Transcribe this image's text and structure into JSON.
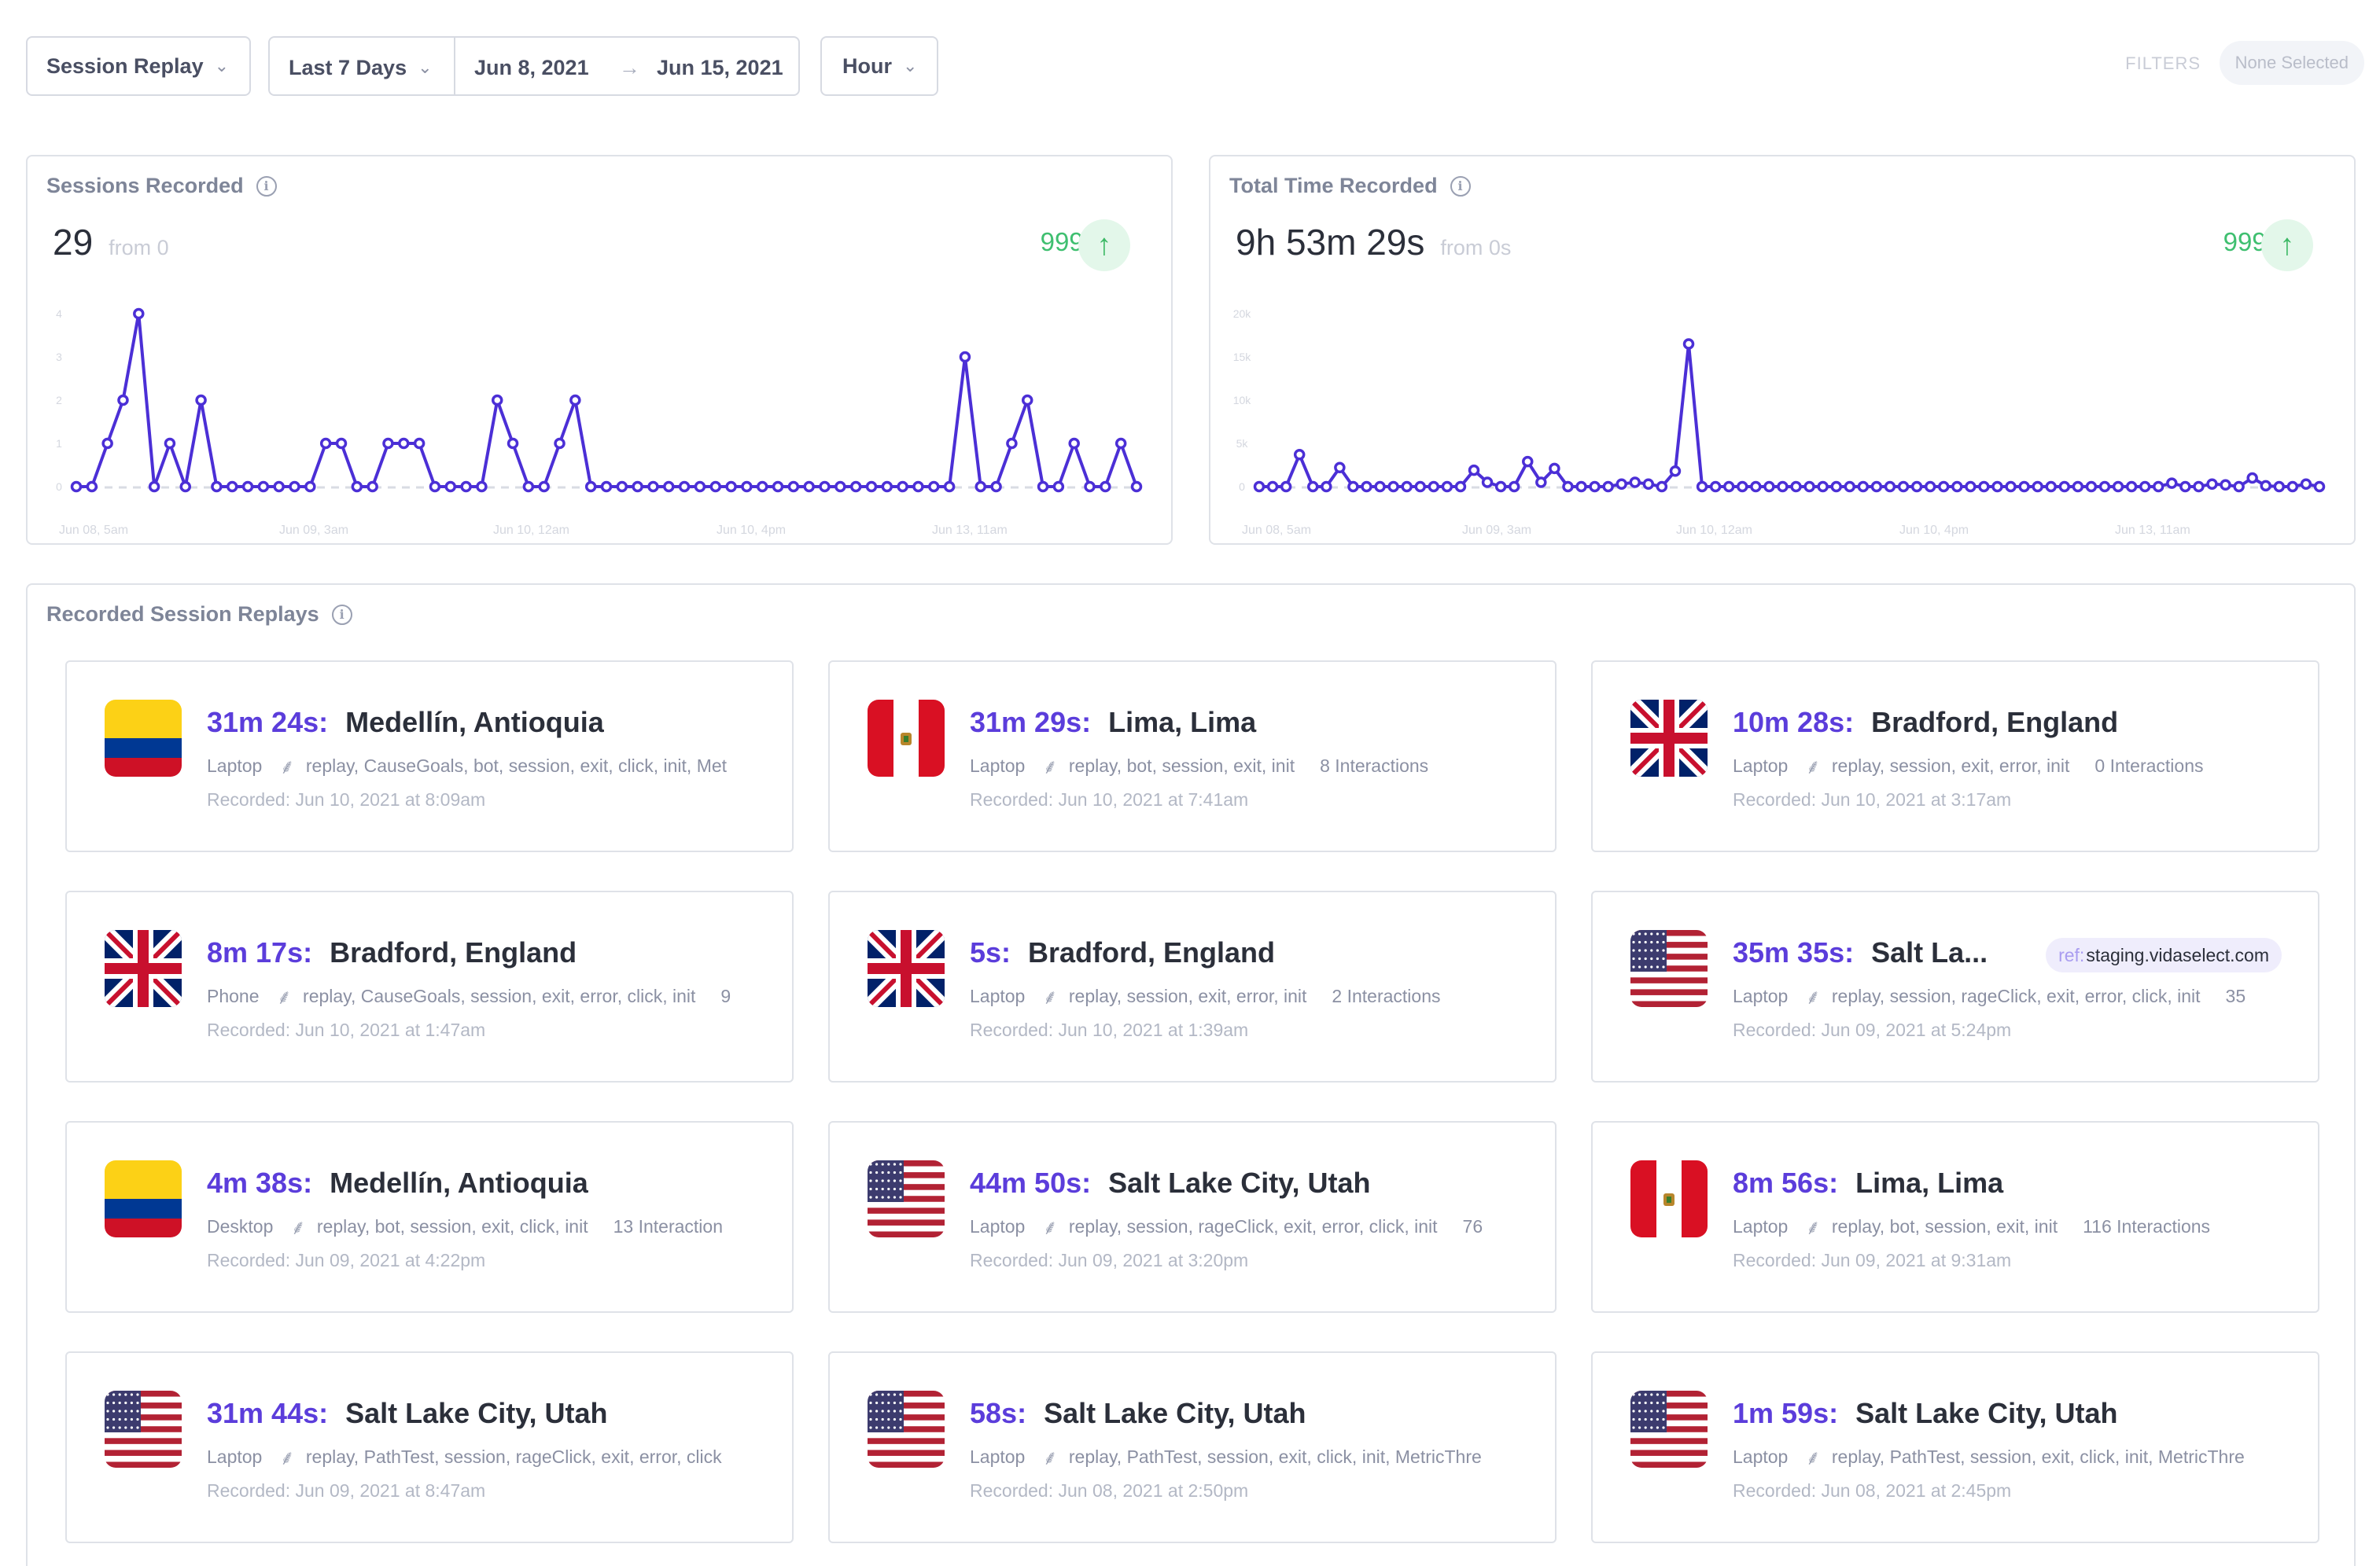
{
  "toolbar": {
    "view_select": "Session Replay",
    "range_select": "Last 7 Days",
    "date_from": "Jun 8, 2021",
    "date_to": "Jun 15, 2021",
    "granularity": "Hour",
    "filters_label": "FILTERS",
    "filters_value": "None Selected"
  },
  "sessions_panel": {
    "title": "Sessions Recorded",
    "value": "29",
    "from": "from 0",
    "change": "999%"
  },
  "time_panel": {
    "title": "Total Time Recorded",
    "value": "9h 53m 29s",
    "from": "from 0s",
    "change": "999%"
  },
  "chart_data": [
    {
      "type": "line",
      "name": "Sessions Recorded",
      "yticks": [
        "0",
        "1",
        "2",
        "3",
        "4"
      ],
      "ylim": [
        0,
        4
      ],
      "xticks": [
        "Jun 08, 5am",
        "Jun 09, 3am",
        "Jun 10, 12am",
        "Jun 10, 4pm",
        "Jun 13, 11am"
      ],
      "values": [
        0,
        0,
        1,
        2,
        4,
        0,
        1,
        0,
        2,
        0,
        0,
        0,
        0,
        0,
        0,
        0,
        1,
        1,
        0,
        0,
        1,
        1,
        1,
        0,
        0,
        0,
        0,
        2,
        1,
        0,
        0,
        1,
        2,
        0,
        0,
        0,
        0,
        0,
        0,
        0,
        0,
        0,
        0,
        0,
        0,
        0,
        0,
        0,
        0,
        0,
        0,
        0,
        0,
        0,
        0,
        0,
        0,
        3,
        0,
        0,
        1,
        2,
        0,
        0,
        1,
        0,
        0,
        1,
        0
      ],
      "color": "#4b2fd6"
    },
    {
      "type": "line",
      "name": "Total Time Recorded",
      "yticks": [
        "0",
        "5k",
        "10k",
        "15k",
        "20k"
      ],
      "ylim": [
        0,
        20000
      ],
      "xticks": [
        "Jun 08, 5am",
        "Jun 09, 3am",
        "Jun 10, 12am",
        "Jun 10, 4pm",
        "Jun 13, 11am"
      ],
      "values": [
        0,
        0,
        0,
        3700,
        0,
        0,
        2200,
        0,
        0,
        0,
        0,
        0,
        0,
        0,
        0,
        0,
        1900,
        500,
        0,
        0,
        2900,
        500,
        2100,
        0,
        0,
        0,
        0,
        300,
        500,
        300,
        0,
        1800,
        16500,
        0,
        0,
        0,
        0,
        0,
        0,
        0,
        0,
        0,
        0,
        0,
        0,
        0,
        0,
        0,
        0,
        0,
        0,
        0,
        0,
        0,
        0,
        0,
        0,
        0,
        0,
        0,
        0,
        0,
        0,
        0,
        0,
        0,
        0,
        0,
        400,
        0,
        0,
        300,
        200,
        0,
        1000,
        100,
        0,
        0,
        300,
        0
      ],
      "color": "#4b2fd6"
    }
  ],
  "replays_panel": {
    "title": "Recorded Session Replays"
  },
  "sessions": [
    {
      "flag": "CO",
      "duration": "31m 24s:",
      "location": "Medellín, Antioquia",
      "device": "Laptop",
      "tags": "replay, CauseGoals, bot, session, exit, click, init, Met",
      "interactions": "",
      "recorded": "Recorded: Jun 10, 2021 at 8:09am",
      "ref": ""
    },
    {
      "flag": "PE",
      "duration": "31m 29s:",
      "location": "Lima, Lima",
      "device": "Laptop",
      "tags": "replay, bot, session, exit, init",
      "interactions": "8 Interactions",
      "recorded": "Recorded: Jun 10, 2021 at 7:41am",
      "ref": ""
    },
    {
      "flag": "GB",
      "duration": "10m 28s:",
      "location": "Bradford, England",
      "device": "Laptop",
      "tags": "replay, session, exit, error, init",
      "interactions": "0 Interactions",
      "recorded": "Recorded: Jun 10, 2021 at 3:17am",
      "ref": ""
    },
    {
      "flag": "GB",
      "duration": "8m 17s:",
      "location": "Bradford, England",
      "device": "Phone",
      "tags": "replay, CauseGoals, session, exit, error, click, init",
      "interactions": "9",
      "recorded": "Recorded: Jun 10, 2021 at 1:47am",
      "ref": ""
    },
    {
      "flag": "GB",
      "duration": "5s:",
      "location": "Bradford, England",
      "device": "Laptop",
      "tags": "replay, session, exit, error, init",
      "interactions": "2 Interactions",
      "recorded": "Recorded: Jun 10, 2021 at 1:39am",
      "ref": ""
    },
    {
      "flag": "US",
      "duration": "35m 35s:",
      "location": "Salt La...",
      "device": "Laptop",
      "tags": "replay, session, rageClick, exit, error, click, init",
      "interactions": "35",
      "recorded": "Recorded: Jun 09, 2021 at 5:24pm",
      "ref_key": "ref:",
      "ref": "staging.vidaselect.com"
    },
    {
      "flag": "CO",
      "duration": "4m 38s:",
      "location": "Medellín, Antioquia",
      "device": "Desktop",
      "tags": "replay, bot, session, exit, click, init",
      "interactions": "13 Interaction",
      "recorded": "Recorded: Jun 09, 2021 at 4:22pm",
      "ref": ""
    },
    {
      "flag": "US",
      "duration": "44m 50s:",
      "location": "Salt Lake City, Utah",
      "device": "Laptop",
      "tags": "replay, session, rageClick, exit, error, click, init",
      "interactions": "76",
      "recorded": "Recorded: Jun 09, 2021 at 3:20pm",
      "ref": ""
    },
    {
      "flag": "PE",
      "duration": "8m 56s:",
      "location": "Lima, Lima",
      "device": "Laptop",
      "tags": "replay, bot, session, exit, init",
      "interactions": "116 Interactions",
      "recorded": "Recorded: Jun 09, 2021 at 9:31am",
      "ref": ""
    },
    {
      "flag": "US",
      "duration": "31m 44s:",
      "location": "Salt Lake City, Utah",
      "device": "Laptop",
      "tags": "replay, PathTest, session, rageClick, exit, error, click",
      "interactions": "",
      "recorded": "Recorded: Jun 09, 2021 at 8:47am",
      "ref": ""
    },
    {
      "flag": "US",
      "duration": "58s:",
      "location": "Salt Lake City, Utah",
      "device": "Laptop",
      "tags": "replay, PathTest, session, exit, click, init, MetricThre",
      "interactions": "",
      "recorded": "Recorded: Jun 08, 2021 at 2:50pm",
      "ref": ""
    },
    {
      "flag": "US",
      "duration": "1m 59s:",
      "location": "Salt Lake City, Utah",
      "device": "Laptop",
      "tags": "replay, PathTest, session, exit, click, init, MetricThre",
      "interactions": "",
      "recorded": "Recorded: Jun 08, 2021 at 2:45pm",
      "ref": ""
    }
  ],
  "icons": {
    "info": "info-icon",
    "arrow_up": "arrow-up-icon",
    "arrow_right": "arrow-right-icon",
    "cursor": "cursor-click-icon",
    "caret": "chevron-down-icon"
  }
}
